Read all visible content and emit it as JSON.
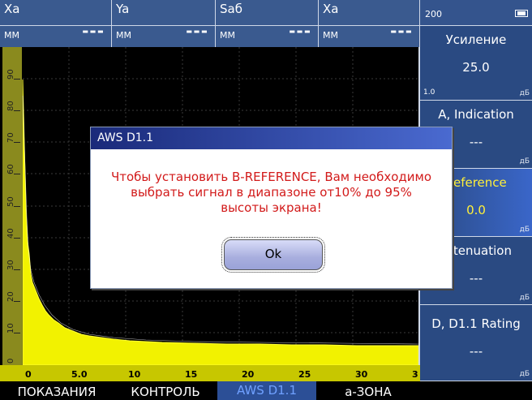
{
  "readouts": [
    {
      "label": "Xa",
      "unit": "MM",
      "value": "---"
    },
    {
      "label": "Ya",
      "unit": "MM",
      "value": "---"
    },
    {
      "label": "Saб",
      "unit": "MM",
      "value": "---"
    },
    {
      "label": "Xa",
      "unit": "MM",
      "value": "---"
    }
  ],
  "right_panel": {
    "top_number": "200",
    "gain": {
      "title": "Усиление",
      "value": "25.0",
      "min": "1.0",
      "unit": "дБ"
    },
    "a_indication": {
      "title": "A, Indication",
      "value": "---",
      "unit": "дБ"
    },
    "reference": {
      "title": "Reference",
      "value": "0.0",
      "unit": "дБ"
    },
    "attenuation": {
      "title": "Attenuation",
      "value": "---",
      "unit": "дБ"
    },
    "rating": {
      "title": "D, D1.1 Rating",
      "value": "---",
      "unit": "дБ"
    }
  },
  "y_scale": [
    "90",
    "80",
    "70",
    "60",
    "50",
    "40",
    "30",
    "20",
    "10",
    "0"
  ],
  "x_scale": [
    "0",
    "5.0",
    "10",
    "15",
    "20",
    "25",
    "30",
    "3"
  ],
  "menu": [
    "ПОКАЗАНИЯ",
    "КОНТРОЛЬ",
    "AWS D1.1",
    "a-ЗОНА"
  ],
  "dialog": {
    "title": "AWS D1.1",
    "message": "Чтобы установить B-REFERENCE, Вам необходимо выбрать сигнал в диапазоне от10% до 95% высоты экрана!",
    "ok": "Ok"
  },
  "colors": {
    "signal": "#ffff00",
    "panel": "#2a4a82",
    "highlight": "#3a66c9",
    "message": "#d21a1a"
  }
}
